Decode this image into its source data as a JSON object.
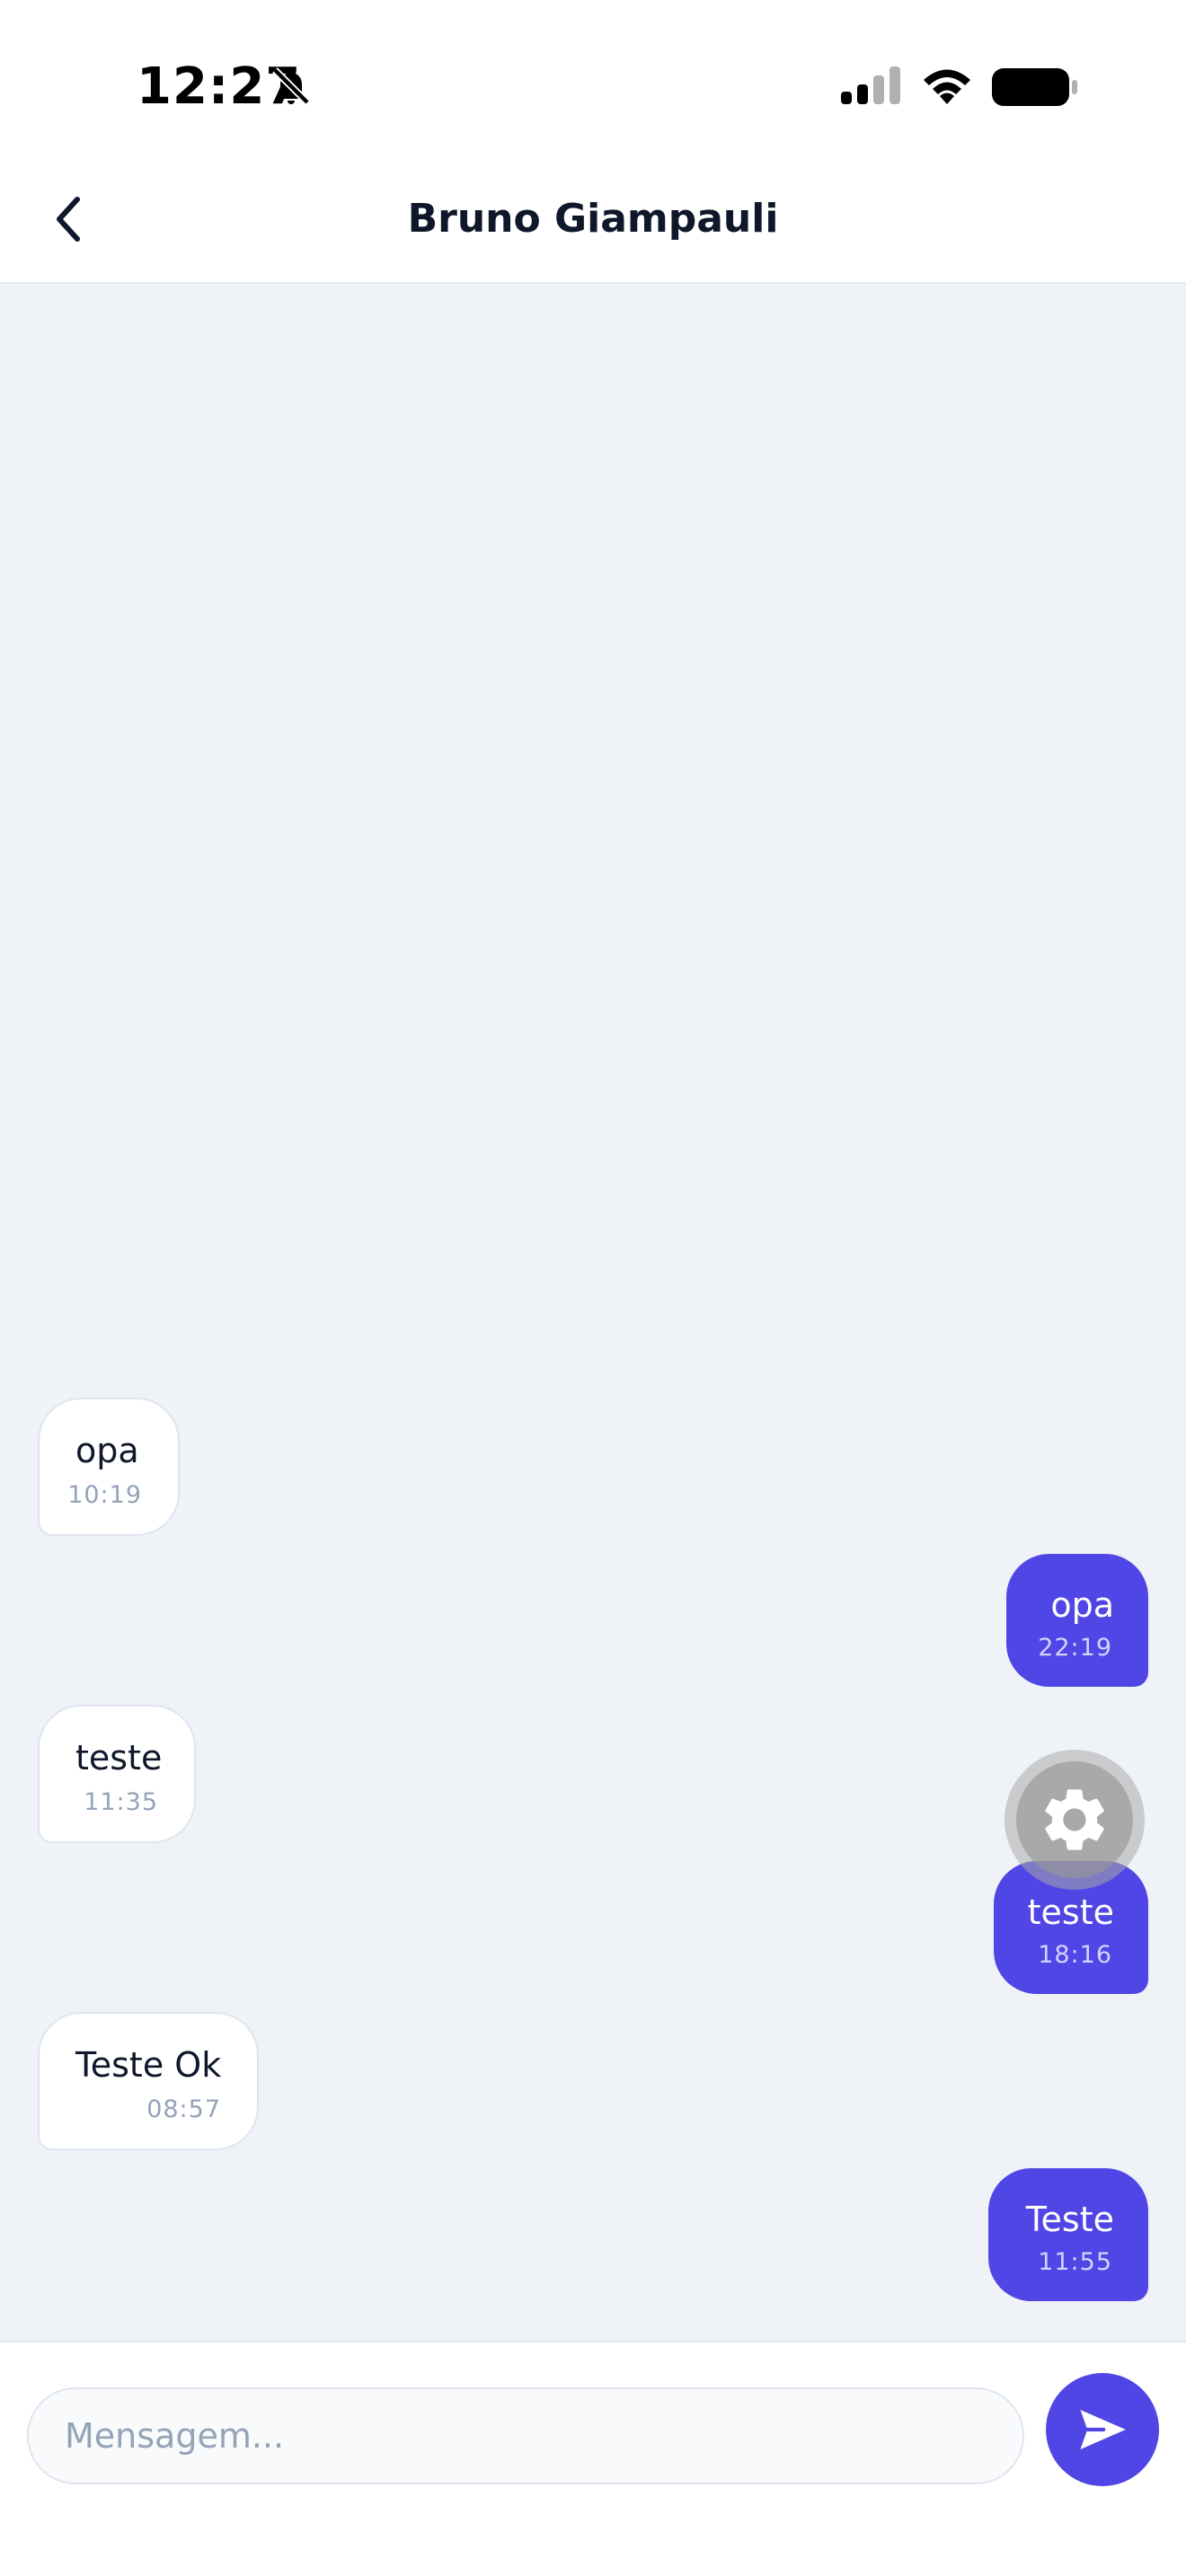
{
  "status_bar": {
    "time": "12:27",
    "icons": [
      "bell-slash-icon",
      "cellular-signal-icon",
      "wifi-icon",
      "battery-icon"
    ]
  },
  "header": {
    "back_icon": "chevron-left-icon",
    "title": "Bruno Giampauli"
  },
  "messages": [
    {
      "direction": "incoming",
      "text": "opa",
      "time": "10:19"
    },
    {
      "direction": "outgoing",
      "text": "opa",
      "time": "22:19"
    },
    {
      "direction": "incoming",
      "text": "teste",
      "time": "11:35"
    },
    {
      "direction": "outgoing",
      "text": "teste",
      "time": "18:16"
    },
    {
      "direction": "incoming",
      "text": "Teste Ok",
      "time": "08:57"
    },
    {
      "direction": "outgoing",
      "text": "Teste",
      "time": "11:55"
    }
  ],
  "floating_button": {
    "icon": "gear-icon"
  },
  "composer": {
    "placeholder": "Mensagem...",
    "value": "",
    "send_icon": "send-arrow-icon"
  },
  "colors": {
    "accent": "#4f46e5",
    "chat_background": "#eff3f8",
    "incoming_bubble": "#ffffff",
    "title_text": "#0f172a",
    "timestamp_text": "#94a3b8"
  }
}
